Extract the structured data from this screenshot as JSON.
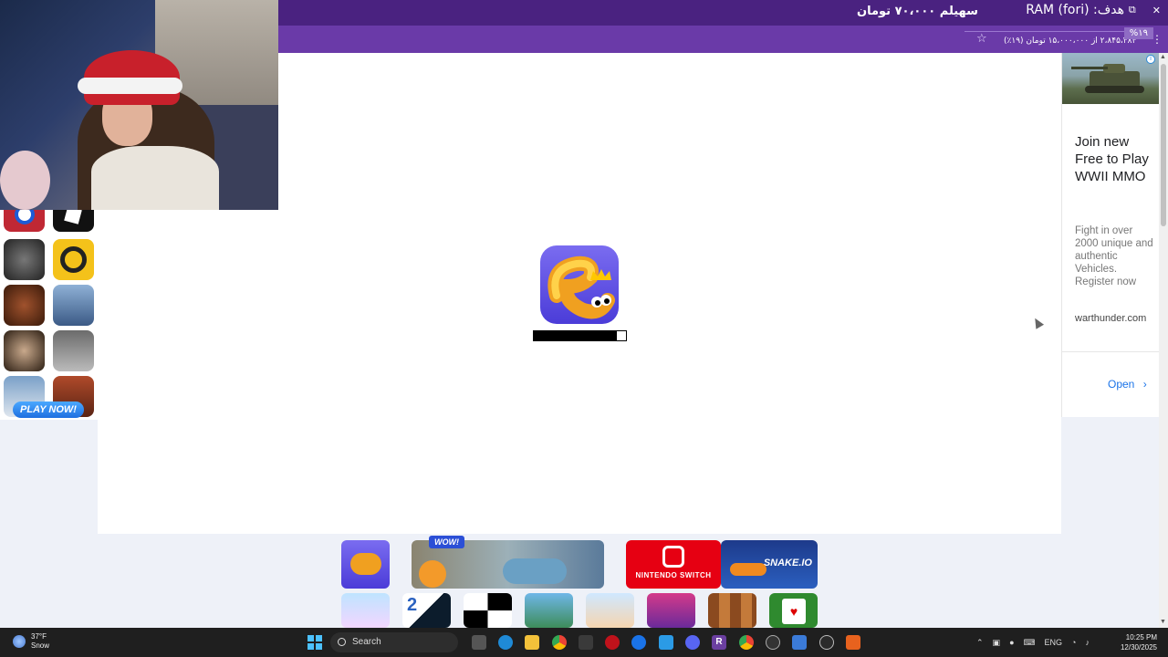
{
  "banner": {
    "right_text": "هدف: RAM (fori)",
    "left_text": "سهیلم ۷۰،۰۰۰ تومان"
  },
  "browser": {
    "ext_text": "۲،۸۴۵،۴۸۴ از ۱۵،۰۰۰،۰۰۰ تومان (۱۹٪)",
    "percent_badge": "%۱۹"
  },
  "left_column": {
    "play_now_label": "PLAY NOW!"
  },
  "game": {
    "name": "slither",
    "loading_progress": 0.9
  },
  "ad": {
    "headline": "Join new Free to Play WWII MMO",
    "description": "Fight in over 2000 unique and authentic Vehicles. Register now",
    "domain": "warthunder.com",
    "open_label": "Open",
    "open_chevron": "›",
    "info_label": "i"
  },
  "more_games": {
    "wow_badge": "WOW!",
    "nintendo_label": "NINTENDO SWITCH",
    "snake_label": "SNAKE.IO",
    "tile_2048_label": "2"
  },
  "taskbar": {
    "weather_temp": "37°F",
    "weather_desc": "Snow",
    "search_label": "Search",
    "language": "ENG",
    "time": "10:25 PM",
    "date": "12/30/2025",
    "app_letter_r": "R"
  },
  "colors": {
    "banner_purple": "#4a2280",
    "browser_purple": "#6a3aa8",
    "accent_blue": "#1a73e8",
    "page_grey": "#eef1f8"
  }
}
